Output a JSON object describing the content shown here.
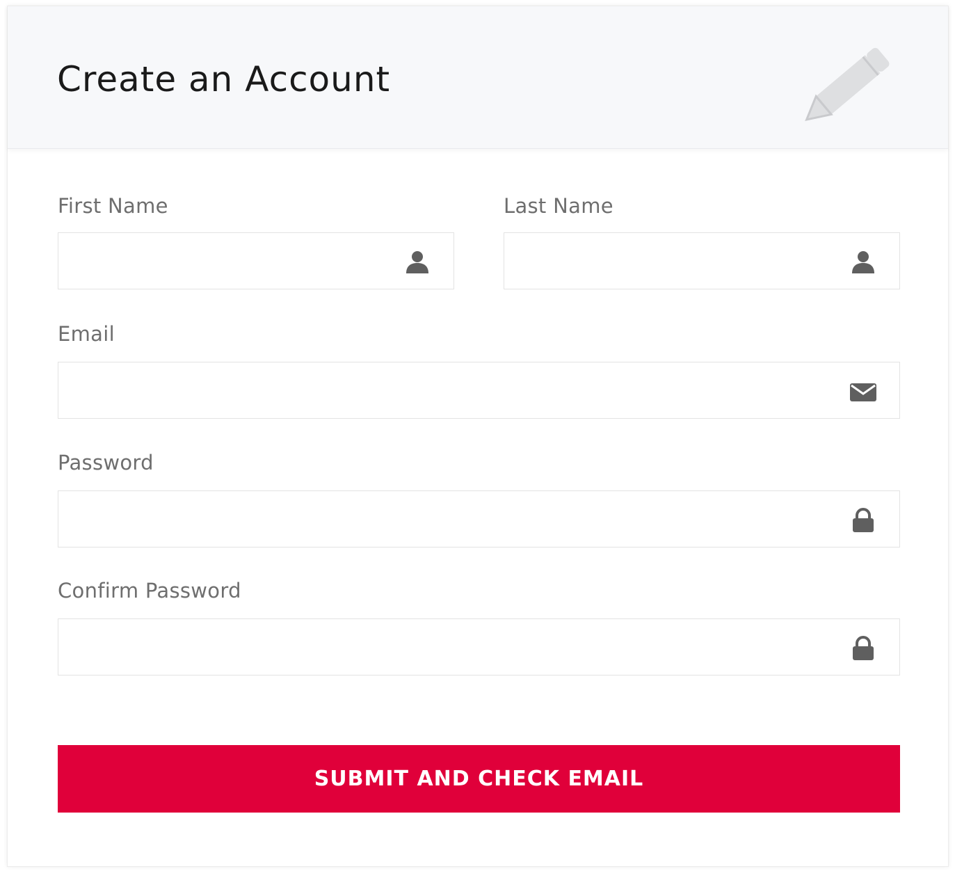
{
  "header": {
    "title": "Create an Account",
    "icon": "pencil-icon"
  },
  "form": {
    "first_name": {
      "label": "First Name",
      "value": "",
      "icon": "user-icon"
    },
    "last_name": {
      "label": "Last Name",
      "value": "",
      "icon": "user-icon"
    },
    "email": {
      "label": "Email",
      "value": "",
      "icon": "envelope-icon"
    },
    "password": {
      "label": "Password",
      "value": "",
      "icon": "lock-icon"
    },
    "confirm_password": {
      "label": "Confirm Password",
      "value": "",
      "icon": "lock-icon"
    }
  },
  "submit": {
    "label": "SUBMIT AND CHECK EMAIL"
  },
  "colors": {
    "accent": "#e0003a",
    "header_bg": "#f7f8fa",
    "label_text": "#6e6e6e",
    "icon": "#5f5f5f"
  }
}
